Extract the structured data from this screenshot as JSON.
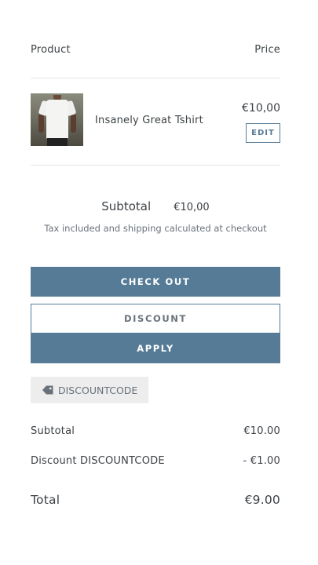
{
  "cart": {
    "header": {
      "product_label": "Product",
      "price_label": "Price"
    },
    "items": [
      {
        "name": "Insanely Great Tshirt",
        "price": "€10,00",
        "edit_label": "EDIT"
      }
    ],
    "subtotal": {
      "label": "Subtotal",
      "value": "€10,00"
    },
    "tax_note": "Tax included and shipping calculated at checkout",
    "checkout_label": "CHECK OUT",
    "discount_field_value": "DISCOUNT",
    "apply_label": "APPLY",
    "applied_code": {
      "icon": "tag-icon",
      "code": "DISCOUNTCODE"
    },
    "summary": {
      "subtotal_label": "Subtotal",
      "subtotal_value": "€10.00",
      "discount_label": "Discount DISCOUNTCODE",
      "discount_value": "- €1.00",
      "total_label": "Total",
      "total_value": "€9.00"
    }
  },
  "colors": {
    "accent": "#557b97",
    "text": "#3d4246",
    "muted": "#69727b",
    "tag_bg": "#ededed",
    "divider": "#e6e6e6"
  }
}
